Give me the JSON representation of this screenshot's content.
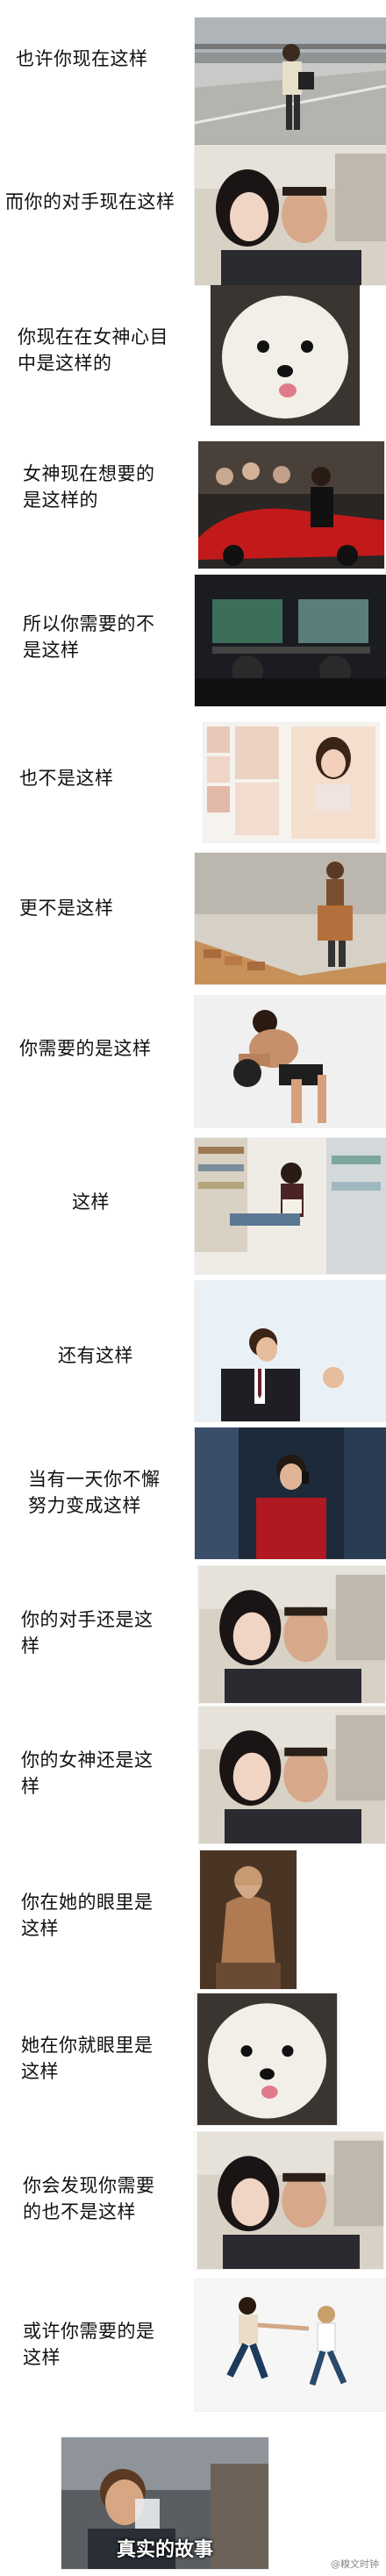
{
  "rows": [
    {
      "caption": "也许你现在这样",
      "image": "man-walking-on-road-with-bag"
    },
    {
      "caption": "而你的对手现在这样",
      "image": "couple-selfie-in-car"
    },
    {
      "caption": "你现在在女神心目\n中是这样的",
      "image": "white-poodle-face"
    },
    {
      "caption": "女神现在想要的\n是这样的",
      "image": "man-with-red-sports-car"
    },
    {
      "caption": "所以你需要的不\n是这样",
      "image": "people-playing-computer-games"
    },
    {
      "caption": "也不是这样",
      "image": "photo-collage-of-woman"
    },
    {
      "caption": "更不是这样",
      "image": "man-carrying-bricks"
    },
    {
      "caption": "你需要的是这样",
      "image": "shirtless-man-lifting-weight"
    },
    {
      "caption": "这样",
      "image": "man-reading-in-library"
    },
    {
      "caption": "还有这样",
      "image": "businessman-in-suit"
    },
    {
      "caption": "当有一天你不懈\n努力变成这样",
      "image": "man-in-red-shirt-on-phone"
    },
    {
      "caption": "你的对手还是这\n样",
      "image": "couple-selfie-in-car"
    },
    {
      "caption": "你的女神还是这\n样",
      "image": "couple-selfie-in-car"
    },
    {
      "caption": "你在她的眼里是\n这样",
      "image": "seated-statue"
    },
    {
      "caption": "她在你就眼里是\n这样",
      "image": "white-poodle-face"
    },
    {
      "caption": "你会发现你需要\n的也不是这样",
      "image": "couple-selfie-in-car"
    },
    {
      "caption": "或许你需要的是\n这样",
      "image": "man-and-woman-holding-hands-running"
    }
  ],
  "final": {
    "caption": "真实的故事",
    "image": "man-drinking-from-glass",
    "watermark": "@糗文时钟"
  },
  "colors": {
    "background": "#ffffff",
    "text": "#111111"
  }
}
